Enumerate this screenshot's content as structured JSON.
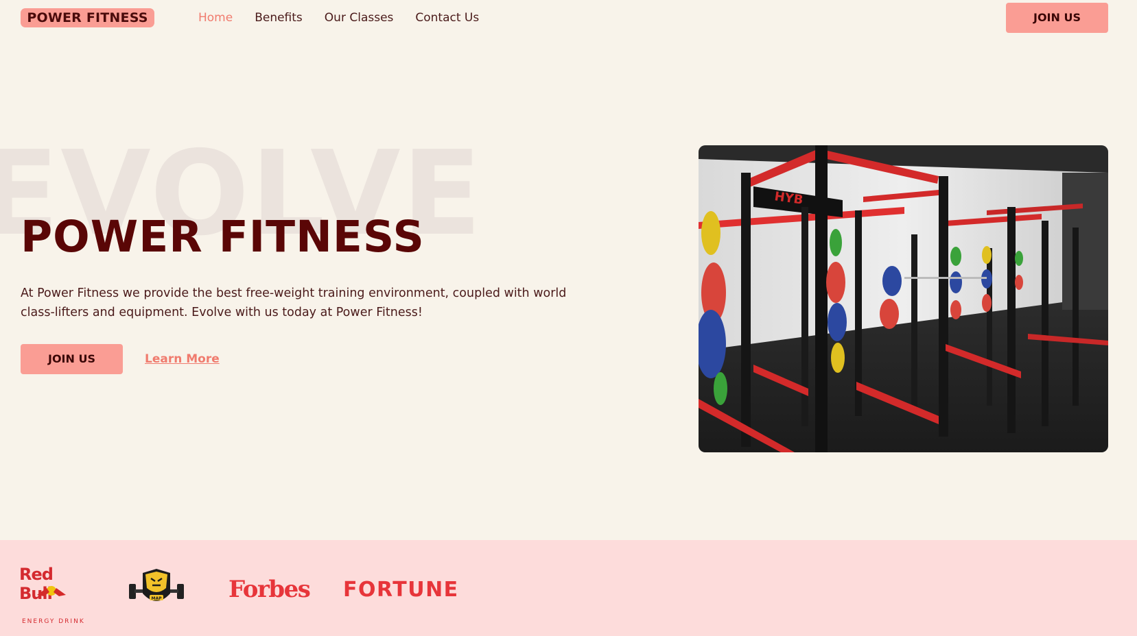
{
  "nav": {
    "brand": "POWER FITNESS",
    "links": [
      {
        "label": "Home",
        "active": true
      },
      {
        "label": "Benefits",
        "active": false
      },
      {
        "label": "Our Classes",
        "active": false
      },
      {
        "label": "Contact Us",
        "active": false
      }
    ],
    "join_label": "JOIN US"
  },
  "hero": {
    "bg_word": "EVOLVE",
    "title": "POWER FITNESS",
    "description": "At Power Fitness we provide the best free-weight training environment, coupled with world class-lifters and equipment. Evolve with us today at Power Fitness!",
    "join_label": "JOIN US",
    "learn_more_label": "Learn More",
    "image_icon": "gym-power-racks-photo"
  },
  "partners": {
    "logos": [
      {
        "name": "Red Bull",
        "sub": "ENERGY DRINK",
        "icon": "redbull-logo"
      },
      {
        "name": "MAP",
        "icon": "tiger-barbell-logo"
      },
      {
        "name": "Forbes",
        "icon": "forbes-logo"
      },
      {
        "name": "FORTUNE",
        "icon": "fortune-logo"
      }
    ]
  },
  "colors": {
    "background": "#f8f3ea",
    "accent": "#fa9d94",
    "accent_text": "#f07b6e",
    "title": "#5a0606",
    "strip": "#fddcdb",
    "logo_red": "#e7353a"
  }
}
